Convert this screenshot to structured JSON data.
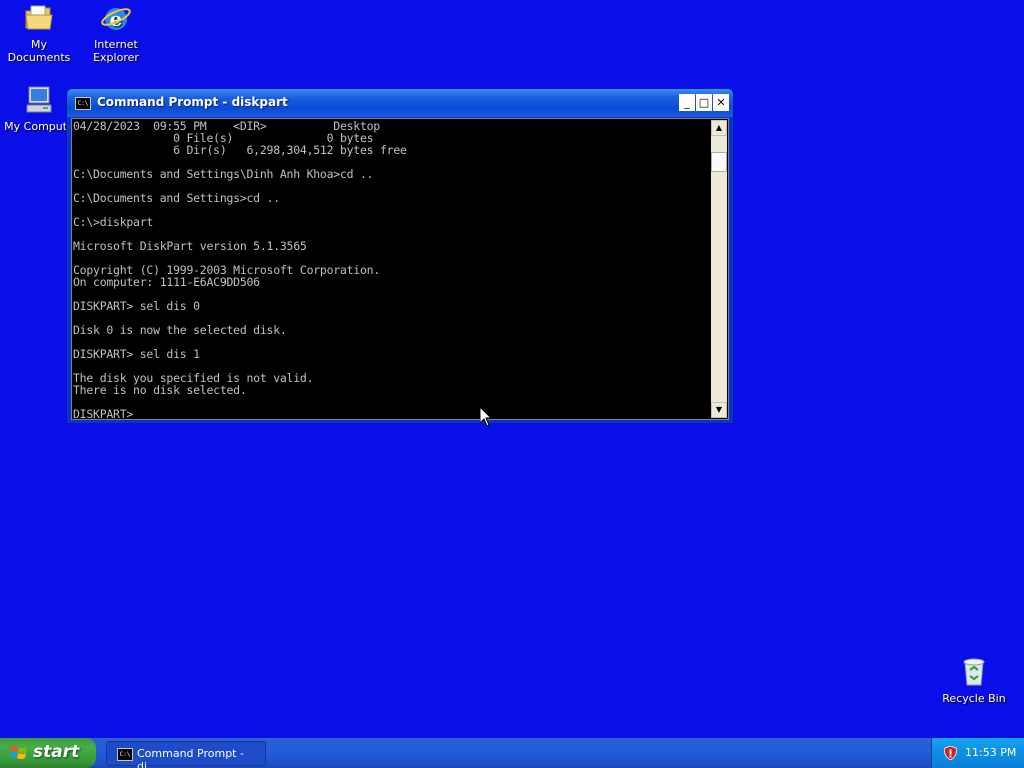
{
  "desktop": {
    "background": "#0a0ee8",
    "icons": [
      {
        "label_lines": [
          "My Documents"
        ],
        "icon": "my-documents-icon"
      },
      {
        "label_lines": [
          "Internet",
          "Explorer"
        ],
        "icon": "internet-explorer-icon"
      },
      {
        "label_lines": [
          "My Compute"
        ],
        "icon": "my-computer-icon"
      },
      {
        "label_lines": [
          "Recycle Bin"
        ],
        "icon": "recycle-bin-icon"
      }
    ]
  },
  "window": {
    "title": "Command Prompt - diskpart",
    "title_icon": "C:\\",
    "buttons": {
      "minimize": "_",
      "maximize": "□",
      "close": "✕"
    },
    "console_lines": [
      "04/28/2023  09:55 PM    <DIR>          Desktop",
      "               0 File(s)              0 bytes",
      "               6 Dir(s)   6,298,304,512 bytes free",
      "",
      "C:\\Documents and Settings\\Dinh Anh Khoa>cd ..",
      "",
      "C:\\Documents and Settings>cd ..",
      "",
      "C:\\>diskpart",
      "",
      "Microsoft DiskPart version 5.1.3565",
      "",
      "Copyright (C) 1999-2003 Microsoft Corporation.",
      "On computer: 1111-E6AC9DD506",
      "",
      "DISKPART> sel dis 0",
      "",
      "Disk 0 is now the selected disk.",
      "",
      "DISKPART> sel dis 1",
      "",
      "The disk you specified is not valid.",
      "There is no disk selected.",
      "",
      "DISKPART> "
    ],
    "console_text_color": "#c0c0c0",
    "console_background": "#000000"
  },
  "taskbar": {
    "start_label": "start",
    "tasks": [
      {
        "label": "Command Prompt - di...",
        "icon": "C:\\"
      }
    ],
    "tray": {
      "time": "11:53 PM",
      "icon": "security-shield-icon"
    }
  }
}
